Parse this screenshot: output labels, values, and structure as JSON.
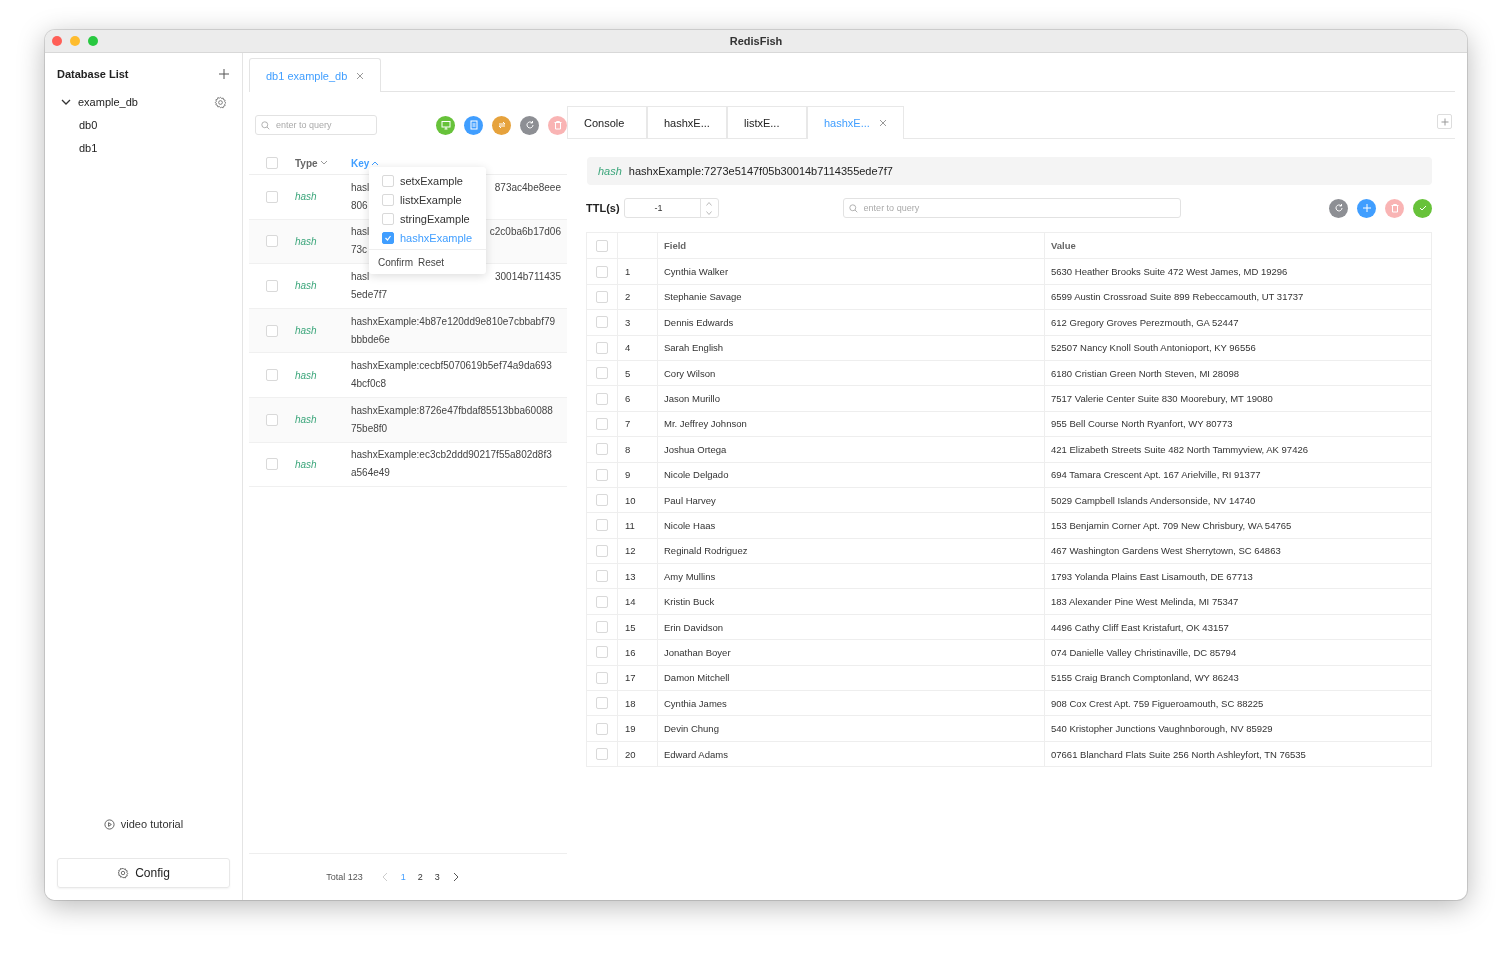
{
  "window": {
    "title": "RedisFish"
  },
  "sidebar": {
    "title": "Database List",
    "databases": [
      {
        "name": "example_db",
        "expanded": true,
        "children": [
          {
            "name": "db0"
          },
          {
            "name": "db1"
          }
        ]
      }
    ],
    "video_link": "video tutorial",
    "config_button": "Config"
  },
  "main_tabs": [
    {
      "label": "db1 example_db",
      "selected": true
    }
  ],
  "key_panel": {
    "search": {
      "placeholder": "enter to query"
    },
    "toolbar": [
      {
        "kind": "new",
        "disabled": false
      },
      {
        "kind": "import",
        "disabled": false
      },
      {
        "kind": "swap",
        "disabled": false
      },
      {
        "kind": "refresh",
        "disabled": false
      },
      {
        "kind": "delete",
        "disabled": true
      }
    ],
    "all_checked": false,
    "columns": [
      {
        "label": "Type",
        "expanded": false
      },
      {
        "label": "Key",
        "expanded": true
      }
    ],
    "filter_menu": {
      "options": [
        {
          "label": "setxExample",
          "checked": false
        },
        {
          "label": "listxExample",
          "checked": false
        },
        {
          "label": "stringExample",
          "checked": false
        },
        {
          "label": "hashxExample",
          "checked": true
        }
      ],
      "buttons": [
        "Confirm",
        "Reset"
      ]
    },
    "rows": [
      {
        "type": "hash",
        "checked": false,
        "lines": [
          [
            "hasl",
            "873ac4be8eee"
          ],
          [
            "806"
          ]
        ]
      },
      {
        "type": "hash",
        "checked": false,
        "lines": [
          [
            "hasl",
            "c2c0ba6b17d06"
          ],
          [
            "73c"
          ]
        ]
      },
      {
        "type": "hash",
        "checked": false,
        "lines": [
          [
            "hasl",
            "30014b711435"
          ],
          [
            "5ede7f7"
          ]
        ]
      },
      {
        "type": "hash",
        "checked": false,
        "lines": [
          [
            "hashxExample:4b87e120dd9e810e7cbbabf79"
          ],
          [
            "bbbde6e"
          ]
        ]
      },
      {
        "type": "hash",
        "checked": false,
        "lines": [
          [
            "hashxExample:cecbf5070619b5ef74a9da693"
          ],
          [
            "4bcf0c8"
          ]
        ]
      },
      {
        "type": "hash",
        "checked": false,
        "lines": [
          [
            "hashxExample:8726e47fbdaf85513bba60088"
          ],
          [
            "75be8f0"
          ]
        ]
      },
      {
        "type": "hash",
        "checked": false,
        "lines": [
          [
            "hashxExample:ec3cb2ddd90217f55a802d8f3"
          ],
          [
            "a564e49"
          ]
        ]
      }
    ],
    "pagination": {
      "total": "Total 123",
      "pages": [
        {
          "label": "1",
          "selected": true
        },
        {
          "label": "2",
          "selected": false
        },
        {
          "label": "3",
          "selected": false
        }
      ]
    }
  },
  "detail_tabs": [
    {
      "label": "Console",
      "selected": false
    },
    {
      "label": "hashxE...",
      "selected": false
    },
    {
      "label": "listxE...",
      "selected": false
    },
    {
      "label": "hashxE...",
      "selected": true
    }
  ],
  "detail": {
    "type": "hash",
    "key": "hashxExample:7273e5147f05b30014b7114355ede7f7",
    "ttl": {
      "label": "TTL(s)",
      "value": "-1"
    },
    "search": {
      "placeholder": "enter to query"
    },
    "actions": [
      {
        "kind": "refresh",
        "disabled": false
      },
      {
        "kind": "add",
        "disabled": false
      },
      {
        "kind": "delete",
        "disabled": true
      },
      {
        "kind": "confirm",
        "disabled": false
      }
    ],
    "table": {
      "all_checked": false,
      "columns": [
        "Field",
        "Value"
      ],
      "rows": [
        {
          "index": "1",
          "field": "Cynthia Walker",
          "value": "5630 Heather Brooks Suite 472 West James, MD 19296",
          "checked": false
        },
        {
          "index": "2",
          "field": "Stephanie Savage",
          "value": "6599 Austin Crossroad Suite 899 Rebeccamouth, UT 31737",
          "checked": false
        },
        {
          "index": "3",
          "field": "Dennis Edwards",
          "value": "612 Gregory Groves Perezmouth, GA 52447",
          "checked": false
        },
        {
          "index": "4",
          "field": "Sarah English",
          "value": "52507 Nancy Knoll South Antonioport, KY 96556",
          "checked": false
        },
        {
          "index": "5",
          "field": "Cory Wilson",
          "value": "6180 Cristian Green North Steven, MI 28098",
          "checked": false
        },
        {
          "index": "6",
          "field": "Jason Murillo",
          "value": "7517 Valerie Center Suite 830 Moorebury, MT 19080",
          "checked": false
        },
        {
          "index": "7",
          "field": "Mr. Jeffrey Johnson",
          "value": "955 Bell Course North Ryanfort, WY 80773",
          "checked": false
        },
        {
          "index": "8",
          "field": "Joshua Ortega",
          "value": "421 Elizabeth Streets Suite 482 North Tammyview, AK 97426",
          "checked": false
        },
        {
          "index": "9",
          "field": "Nicole Delgado",
          "value": "694 Tamara Crescent Apt. 167 Arielville, RI 91377",
          "checked": false
        },
        {
          "index": "10",
          "field": "Paul Harvey",
          "value": "5029 Campbell Islands Andersonside, NV 14740",
          "checked": false
        },
        {
          "index": "11",
          "field": "Nicole Haas",
          "value": "153 Benjamin Corner Apt. 709 New Chrisbury, WA 54765",
          "checked": false
        },
        {
          "index": "12",
          "field": "Reginald Rodriguez",
          "value": "467 Washington Gardens West Sherrytown, SC 64863",
          "checked": false
        },
        {
          "index": "13",
          "field": "Amy Mullins",
          "value": "1793 Yolanda Plains East Lisamouth, DE 67713",
          "checked": false
        },
        {
          "index": "14",
          "field": "Kristin Buck",
          "value": "183 Alexander Pine West Melinda, MI 75347",
          "checked": false
        },
        {
          "index": "15",
          "field": "Erin Davidson",
          "value": "4496 Cathy Cliff East Kristafurt, OK 43157",
          "checked": false
        },
        {
          "index": "16",
          "field": "Jonathan Boyer",
          "value": "074 Danielle Valley Christinaville, DC 85794",
          "checked": false
        },
        {
          "index": "17",
          "field": "Damon Mitchell",
          "value": "5155 Craig Branch Comptonland, WY 86243",
          "checked": false
        },
        {
          "index": "18",
          "field": "Cynthia James",
          "value": "908 Cox Crest Apt. 759 Figueroamouth, SC 88225",
          "checked": false
        },
        {
          "index": "19",
          "field": "Devin Chung",
          "value": "540 Kristopher Junctions Vaughnborough, NV 85929",
          "checked": false
        },
        {
          "index": "20",
          "field": "Edward Adams",
          "value": "07661 Blanchard Flats Suite 256 North Ashleyfort, TN 76535",
          "checked": false
        }
      ]
    }
  }
}
